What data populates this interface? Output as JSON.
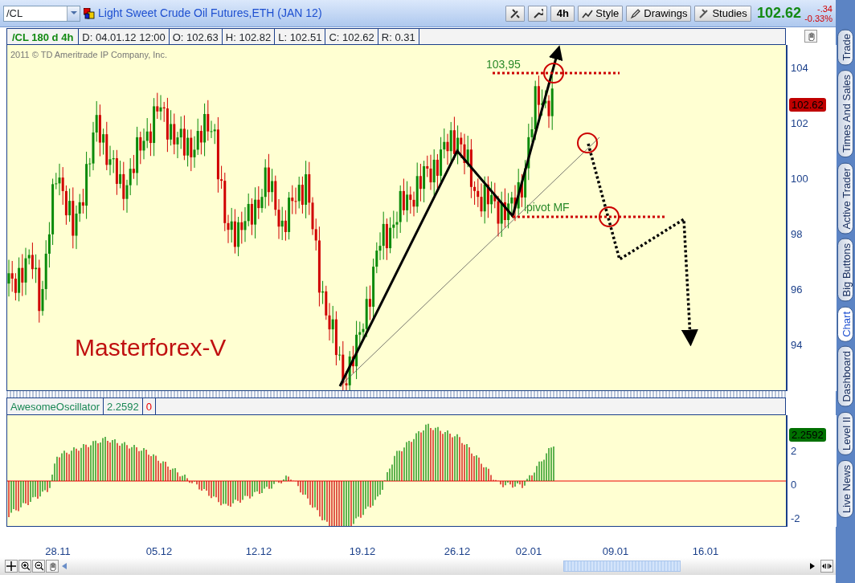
{
  "toolbar": {
    "symbol": "/CL",
    "description": "Light Sweet Crude Oil Futures,ETH (JAN 12)",
    "aggregation": "4h",
    "buttons": [
      {
        "label": "Style",
        "kind": "style"
      },
      {
        "label": "Drawings",
        "kind": "drawings"
      },
      {
        "label": "Studies",
        "kind": "studies"
      }
    ],
    "last_price": "102.62",
    "change": "-.34",
    "change_percent": "-0.33%"
  },
  "info_bar": [
    {
      "text": "/CL 180 d 4h",
      "kind": "symbol"
    },
    {
      "text": "D: 04.01.12 12:00",
      "kind": "field"
    },
    {
      "text": "O: 102.63",
      "kind": "field"
    },
    {
      "text": "H: 102.82",
      "kind": "field"
    },
    {
      "text": "L: 102.51",
      "kind": "field"
    },
    {
      "text": "C: 102.62",
      "kind": "field"
    },
    {
      "text": "R: 0.31",
      "kind": "field"
    }
  ],
  "price_panel": {
    "copyright": "2011 © TD Ameritrade IP Company, Inc.",
    "annotations": [
      {
        "text": "103,95",
        "kind": "target"
      },
      {
        "text": "pivot MF",
        "kind": "pivot"
      }
    ],
    "caption": "Masterforex-V",
    "axis_ticks": [
      "104",
      "102",
      "100",
      "98",
      "96",
      "94"
    ],
    "last_price_tag": "102.62"
  },
  "oscillator": {
    "name": "AwesomeOscillator",
    "value": "2.2592",
    "second_value": "0",
    "axis_ticks": [
      "2",
      "0",
      "-2"
    ],
    "value_tag": "2.2592"
  },
  "date_axis": [
    "28.11",
    "05.12",
    "12.12",
    "19.12",
    "26.12",
    "02.01",
    "09.01",
    "16.01"
  ],
  "side_tabs": [
    {
      "label": "Trade",
      "selected": false
    },
    {
      "label": "Times And Sales",
      "selected": false
    },
    {
      "label": "Active Trader",
      "selected": false
    },
    {
      "label": "Big Buttons",
      "selected": false
    },
    {
      "label": "Chart",
      "selected": true
    },
    {
      "label": "Dashboard",
      "selected": false
    },
    {
      "label": "Level II",
      "selected": false
    },
    {
      "label": "Live News",
      "selected": false
    }
  ]
}
